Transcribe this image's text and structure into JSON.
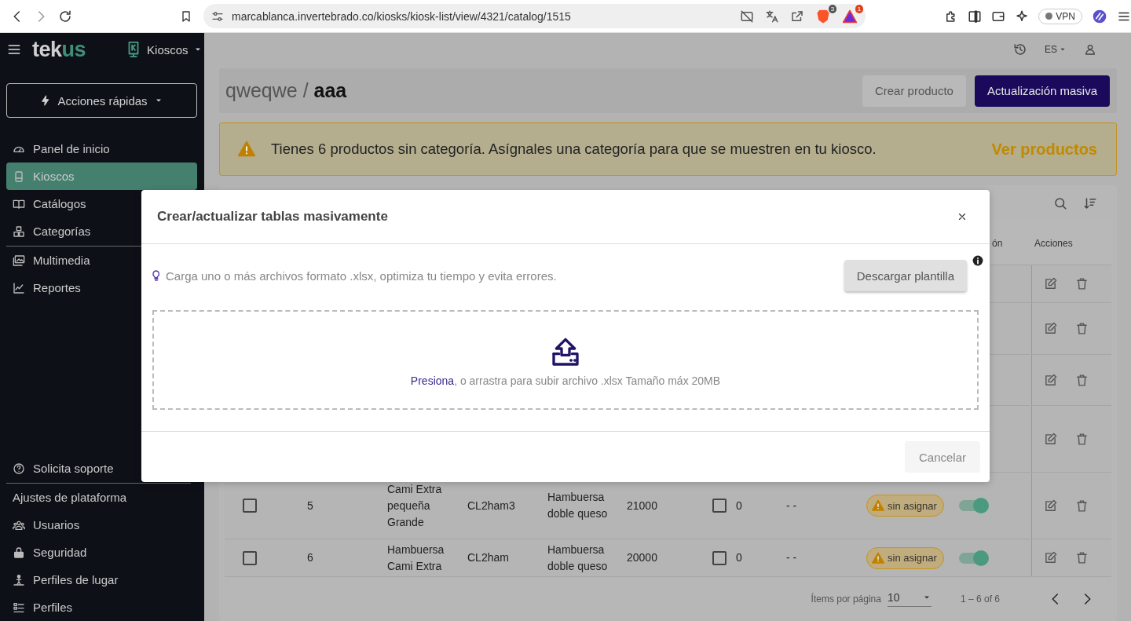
{
  "browser": {
    "url": "marcablanca.invertebrado.co/kiosks/kiosk-list/view/4321/catalog/1515",
    "extension_badges": [
      "3",
      "1"
    ],
    "vpn": {
      "label": "VPN",
      "on": false
    }
  },
  "sidebar": {
    "logo": {
      "first": "tek",
      "second": "us"
    },
    "module": "Kioscos",
    "quick_actions": "Acciones rápidas",
    "items": [
      {
        "label": "Panel de inicio",
        "selected": false
      },
      {
        "label": "Kioscos",
        "selected": true
      },
      {
        "label": "Catálogos",
        "selected": false
      },
      {
        "label": "Categorías",
        "selected": false
      },
      {
        "label": "Multimedia",
        "selected": false
      },
      {
        "label": "Reportes",
        "selected": false
      }
    ],
    "support": {
      "label": "Solicita soporte",
      "selected": false
    },
    "settings_title": "Ajustes de plataforma",
    "settings_items": [
      {
        "label": "Usuarios",
        "selected": false
      },
      {
        "label": "Seguridad",
        "selected": false
      },
      {
        "label": "Perfiles de lugar",
        "selected": false
      },
      {
        "label": "Perfiles",
        "selected": false
      }
    ]
  },
  "topbar": {
    "language": "ES"
  },
  "page": {
    "breadcrumb": "qweqwe / **aaa**",
    "buttons": [
      {
        "label": "Crear producto",
        "kind": "secondary"
      },
      {
        "label": "Actualización masiva",
        "kind": "primary"
      }
    ]
  },
  "alert": {
    "message": "Tienes 6 productos sin categoría. Asígnales una categoría para que se muestren en tu kiosco.",
    "action": "Ver productos"
  },
  "table": {
    "header": {
      "column_10": "ón",
      "actions": "Acciones"
    },
    "rows": [
      {
        "kind": "covered"
      },
      {
        "kind": "covered"
      },
      {
        "kind": "covered"
      },
      {
        "kind": "covered"
      },
      {
        "kind": "product",
        "selected": false,
        "number": "5",
        "name": "Cami Extra pequeña Grande",
        "code": "CL2ham3",
        "category": "Hambuersa doble queso",
        "price": "21000",
        "stock_checked": false,
        "stock": "0",
        "column_8": "- -",
        "status": "sin asignar",
        "active": true
      },
      {
        "kind": "product",
        "selected": false,
        "number": "6",
        "name": "Hambuersa Cami Extra",
        "code": "CL2ham",
        "category": "Hambuersa doble queso",
        "price": "20000",
        "stock_checked": false,
        "stock": "0",
        "column_8": "- -",
        "status": "sin asignar",
        "active": true
      }
    ],
    "pagination": {
      "label": "Ítems por página",
      "page_size": "10",
      "range": "1 – 6 of 6"
    }
  },
  "modal": {
    "title": "Crear/actualizar tablas masivamente",
    "hint": "Carga uno o más archivos formato .xlsx, optimiza tu tiempo y evita errores.",
    "download_button": "Descargar plantilla",
    "dropzone": {
      "link": "Presiona",
      "text": ", o arrastra para subir archivo .xlsx Tamaño máx 20MB"
    },
    "cancel_button": "Cancelar"
  }
}
